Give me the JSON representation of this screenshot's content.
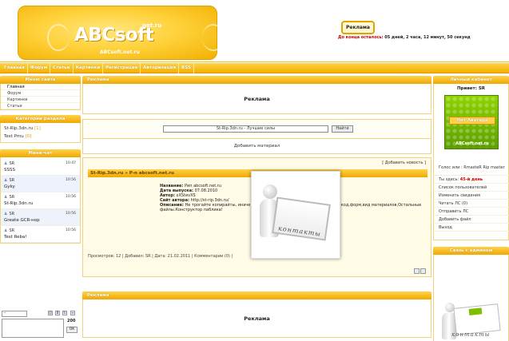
{
  "header": {
    "logo_text": "ABCsoft",
    "logo_net": "net.ru",
    "logo_sub": "ABCsoft.net.ru",
    "ad_badge": "Реклама",
    "countdown_label": "До конца осталось:",
    "countdown_value": "05 дней, 2 часа, 12 минут, 50 секунд"
  },
  "nav": [
    "Главная",
    "Форум",
    "Статьи",
    "Картинки",
    "Регистрация",
    "Авторизация",
    "RSS"
  ],
  "left": {
    "menu_title": "Меню сайта",
    "menu_items": [
      "Главная",
      "Форум",
      "Картинки",
      "Статьи"
    ],
    "cat_title": "Категории раздела",
    "categories": [
      {
        "name": "St-Rip.3dn.ru",
        "count": "[1]"
      },
      {
        "name": "Test Pmu",
        "count": "[0]"
      }
    ],
    "chat_title": "Мини-чат",
    "chat": [
      {
        "user": "SR",
        "time": "10:47",
        "text": "SSSS"
      },
      {
        "user": "SR",
        "time": "10:56",
        "text": "Gyky"
      },
      {
        "user": "SR",
        "time": "10:56",
        "text": "St-Rip.3dn.ru"
      },
      {
        "user": "SR",
        "time": "10:56",
        "text": "Greate GCR-нop"
      },
      {
        "user": "SR",
        "time": "10:56",
        "text": "Test Reba!"
      }
    ],
    "chat_select": "--",
    "chat_count": "200",
    "chat_ok": "OK"
  },
  "main": {
    "ad_title": "Реклама",
    "ad_text": "Реклама",
    "search_value": "St-Rip.3dn.ru - Лучшие силы",
    "search_button": "Найти",
    "add_material": "Добавить материал",
    "add_news": "[ Добавить новость ]",
    "news_title": "St-Rip.3dn.ru » P-n abcsoft.net.ru",
    "news_fields": [
      {
        "label": "Название:",
        "value": "Рип abcsoft.net.ru"
      },
      {
        "label": "Дата выпуска:",
        "value": "07.08.2010"
      },
      {
        "label": "Автор:",
        "value": "xXStevXS"
      },
      {
        "label": "Сайт автора:",
        "value": "http://st-rip.3dn.ru/"
      },
      {
        "label": "Описание:",
        "value": "Не трогайте копирайты, иначе появятся картинки, таблица стилей ,html код,форм,вид материалов,Остальные файлы.Конструктор паблика!"
      }
    ],
    "news_footer": "Просмотров: 12 | Добавил: SR | Дата: 21.02.2011 | Комментарии (0) |",
    "popup_card": "контакты",
    "ad2_title": "Реклама",
    "ad2_text": "Реклама"
  },
  "right": {
    "profile_title": "Личный кабинет",
    "greet": "Привет: SR",
    "avatar_label": "Нет Аватара",
    "avatar_site": "ABCsoft.net.ru",
    "status": "Голос или : RmasteR Rip master",
    "day_prefix": "Ты здесь:",
    "day_value": "45-й день",
    "links": [
      "Список пользователей",
      "Изменить сведения",
      "Читать ЛС (0)",
      "Отправить ЛС",
      "Добавить файл",
      "Выход"
    ],
    "contact_title": "Связь с админом",
    "contact_card": "контакты"
  }
}
